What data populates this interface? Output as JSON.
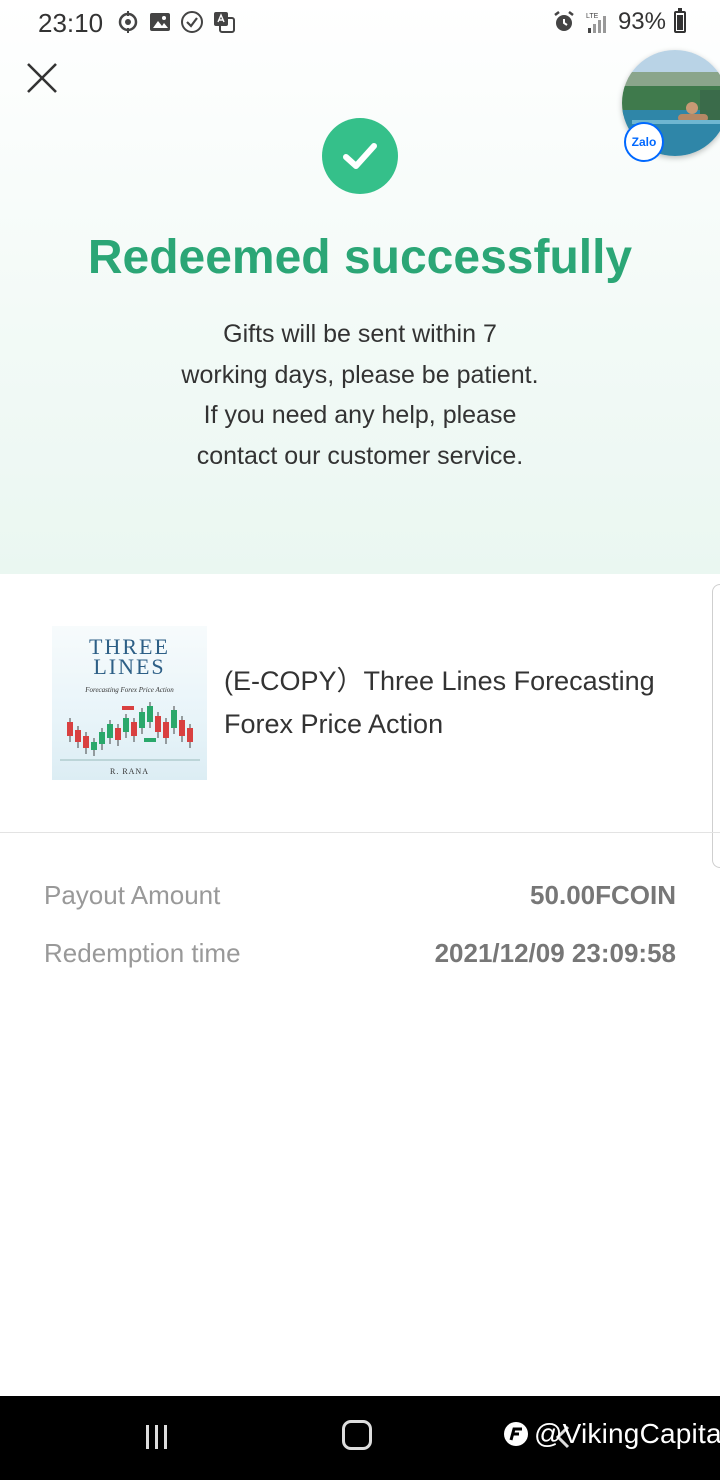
{
  "status_bar": {
    "time": "23:10",
    "network": "LTE",
    "battery_percent": "93%",
    "battery_level": 0.93,
    "icons_left": [
      "sync-icon",
      "image-icon",
      "check-circle-icon",
      "translate-icon"
    ],
    "icons_right": [
      "alarm-icon",
      "signal-icon",
      "battery-icon"
    ]
  },
  "header": {
    "close_icon": "close-icon"
  },
  "floating_bubble": {
    "badge_label": "Zalo"
  },
  "result": {
    "icon": "check-circle-icon",
    "title": "Redeemed successfully",
    "message": "Gifts will be sent within 7 working days, please be patient. If you need any help, please contact our customer service."
  },
  "product": {
    "cover": {
      "title_line1": "THREE",
      "title_line2": "LINES",
      "subtitle": "Forecasting Forex Price Action",
      "author": "R. RANA"
    },
    "name": "(E-COPY）Three Lines Forecasting Forex Price Action"
  },
  "details": [
    {
      "label": "Payout Amount",
      "value": "50.00FCOIN"
    },
    {
      "label": "Redemption time",
      "value": "2021/12/09 23:09:58"
    }
  ],
  "nav_bar": {
    "buttons": [
      "recent-apps",
      "home",
      "back"
    ]
  },
  "watermark": {
    "text": "@VikingCapital"
  },
  "colors": {
    "accent_green": "#2ba676",
    "check_green": "#35c08a",
    "label_gray": "#999999",
    "value_gray": "#777777"
  }
}
